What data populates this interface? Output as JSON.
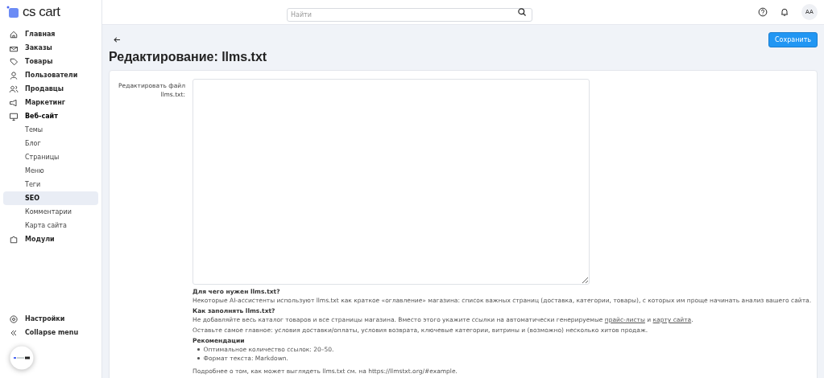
{
  "logo": {
    "text": "cs cart"
  },
  "sidebar": {
    "items": [
      {
        "label": "Главная",
        "selected": false
      },
      {
        "label": "Заказы",
        "selected": false
      },
      {
        "label": "Товары",
        "selected": false
      },
      {
        "label": "Пользователи",
        "selected": false
      },
      {
        "label": "Продавцы",
        "selected": false
      },
      {
        "label": "Маркетинг",
        "selected": false
      },
      {
        "label": "Веб-сайт",
        "selected": false,
        "expanded": true,
        "children": [
          {
            "label": "Темы",
            "selected": false
          },
          {
            "label": "Блог",
            "selected": false
          },
          {
            "label": "Страницы",
            "selected": false
          },
          {
            "label": "Меню",
            "selected": false
          },
          {
            "label": "Теги",
            "selected": false
          },
          {
            "label": "SEO",
            "selected": true
          },
          {
            "label": "Комментарии",
            "selected": false
          },
          {
            "label": "Карта сайта",
            "selected": false
          }
        ]
      },
      {
        "label": "Модули",
        "selected": false
      }
    ],
    "bottom_items": [
      {
        "label": "Настройки"
      },
      {
        "label": "Collapse menu"
      }
    ]
  },
  "topbar": {
    "search": {
      "placeholder": "Найти"
    },
    "avatar": "AA"
  },
  "page": {
    "title": "Редактирование: llms.txt",
    "save_button": "Сохранить"
  },
  "form": {
    "field_label": "Редактировать файл llms.txt:",
    "help": [
      {
        "kind": "heading",
        "text": "Для чего нужен llms.txt?"
      },
      {
        "kind": "text",
        "text": "Некоторые AI-ассистенты используют llms.txt как краткое «оглавление» магазина: список важных страниц (доставка, категории, товары), с которых им проще начинать анализ вашего сайта."
      },
      {
        "kind": "heading",
        "text": "Как заполнять llms.txt?"
      },
      {
        "kind": "links",
        "parts": [
          "Не добавляйте весь каталог товаров и все страницы магазина. Вместо этого укажите ссылки на автоматически генерируемые ",
          "прайс-листы",
          " и ",
          "карту сайта",
          "."
        ]
      },
      {
        "kind": "text",
        "text": "Оставьте самое главное: условия доставки/оплаты, условия возврата, ключевые категории, витрины и (возможно) несколько хитов продаж."
      },
      {
        "kind": "heading",
        "text": "Рекомендации"
      },
      {
        "kind": "list",
        "items": [
          "Оптимальное количество ссылок: 20–50.",
          "Формат текста: Markdown."
        ]
      },
      {
        "kind": "text",
        "text": "Подробнее о том, как может выглядеть llms.txt см. на https://llmstxt.org/#example."
      }
    ]
  }
}
